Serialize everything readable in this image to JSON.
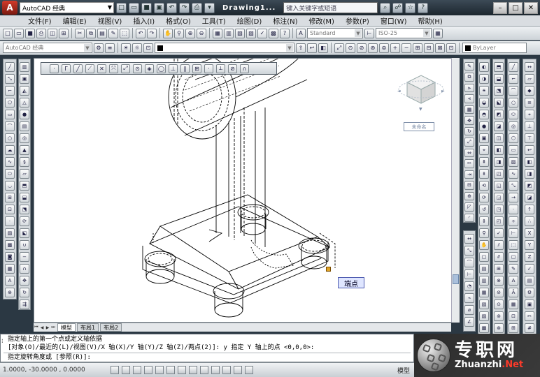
{
  "titlebar": {
    "app_button": "A",
    "workspace": "AutoCAD 经典",
    "title": "Drawing1...",
    "search_placeholder": "键入关键字或短语"
  },
  "menu": [
    "文件(F)",
    "编辑(E)",
    "视图(V)",
    "插入(I)",
    "格式(O)",
    "工具(T)",
    "绘图(D)",
    "标注(N)",
    "修改(M)",
    "参数(P)",
    "窗口(W)",
    "帮助(H)"
  ],
  "toolbar": {
    "text_style": "Standard",
    "dim_style": "ISO-25",
    "layer": "AutoCAD 经典",
    "bylayer": "ByLayer"
  },
  "viewcube": {
    "label": "未命名"
  },
  "tooltip": "端点",
  "tabs": [
    "模型",
    "布局1",
    "布局2"
  ],
  "command": {
    "line1": "指定轴上的第一个点或定义轴依据",
    "line2": "[对象(O)/最近的(L)/视图(V)/X 轴(X)/Y 轴(Y)/Z 轴(Z)/两点(2)]: y 指定 Y 轴上的点 <0,0,0>:",
    "line3": "指定旋转角度或 [参照(R)]:"
  },
  "status": {
    "coords": "1.0000, -30.0000 , 0.0000",
    "model": "模型"
  },
  "logo": {
    "cn": "专职网",
    "en_left": "Zhuanzhi",
    "en_right": ".Net"
  }
}
